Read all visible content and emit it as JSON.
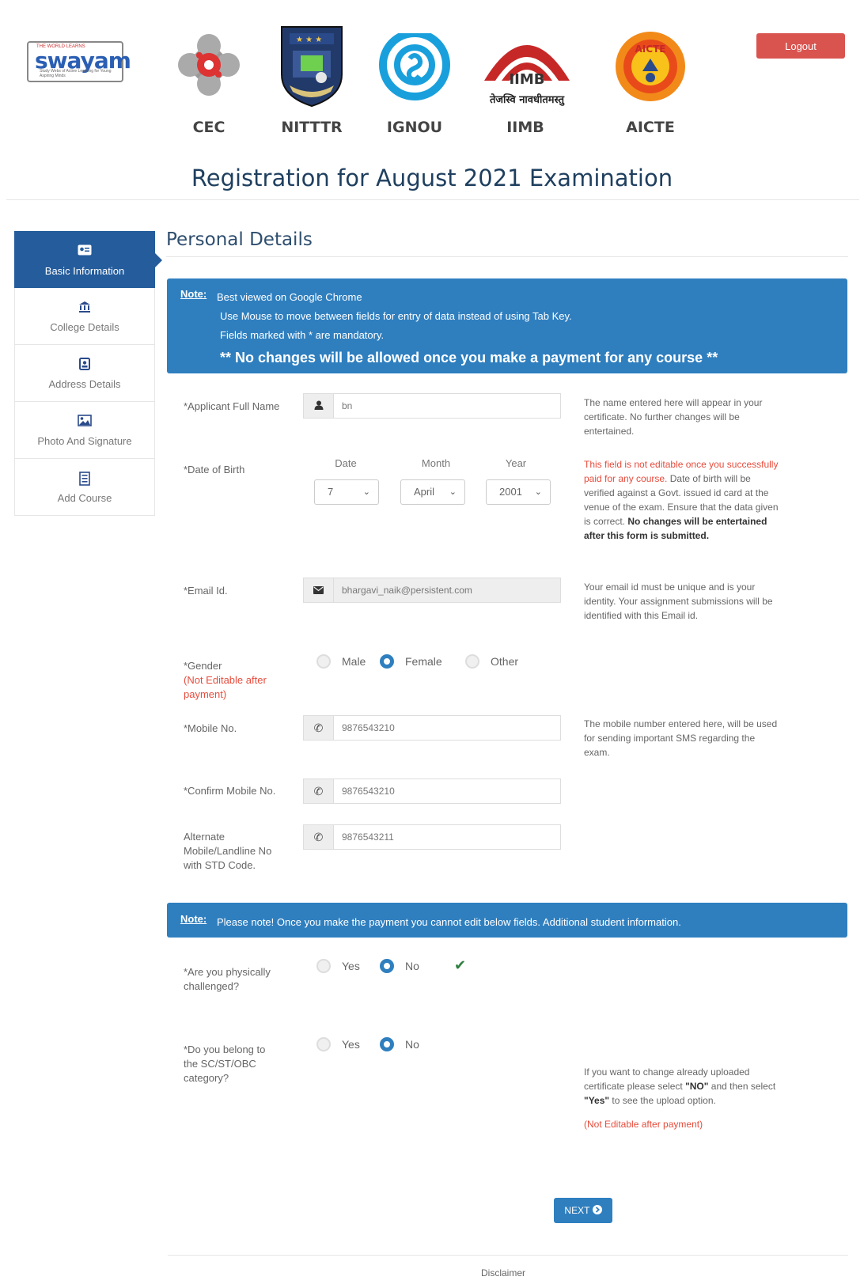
{
  "header": {
    "logo_top": "THE WORLD LEARNS",
    "logo_text": "swayam",
    "logo_sub": "Study Webs of Active Learning for Young Aspiring Minds",
    "partners": [
      {
        "label": "CEC",
        "icon": "cec-logo"
      },
      {
        "label": "NITTTR",
        "icon": "nitttr-crest"
      },
      {
        "label": "IGNOU",
        "icon": "ignou-logo"
      },
      {
        "label": "IIMB",
        "icon": "iimb-logo",
        "emblem_text": "IIMB",
        "motto": "तेजस्वि नावधीतमस्तु"
      },
      {
        "label": "AICTE",
        "icon": "aicte-logo",
        "emblem_text": "AICTE"
      }
    ],
    "logout_label": "Logout",
    "title": "Registration for August 2021 Examination"
  },
  "sidebar": {
    "items": [
      {
        "label": "Basic Information",
        "icon": "id-card-icon",
        "active": true
      },
      {
        "label": "College Details",
        "icon": "institution-icon",
        "active": false
      },
      {
        "label": "Address Details",
        "icon": "address-book-icon",
        "active": false
      },
      {
        "label": "Photo And Signature",
        "icon": "image-icon",
        "active": false
      },
      {
        "label": "Add Course",
        "icon": "list-icon",
        "active": false
      }
    ]
  },
  "main": {
    "title": "Personal Details",
    "note1": {
      "label": "Note:",
      "lines": [
        "Best viewed on Google Chrome",
        "Use Mouse to move between fields for entry of data instead of using Tab Key.",
        "Fields marked with * are mandatory."
      ],
      "big": "** No changes will be allowed once you make a payment for any course **"
    },
    "fields": {
      "name": {
        "label": "*Applicant Full Name",
        "value": "bn",
        "help": "The name entered here will appear in your certificate. No further changes will be entertained."
      },
      "dob": {
        "label": "*Date of Birth",
        "date_head": "Date",
        "month_head": "Month",
        "year_head": "Year",
        "date": "7",
        "month": "April",
        "year": "2001",
        "help_red": "This field is not editable once you successfully paid for any course.",
        "help": "Date of birth will be verified against a Govt. issued id card at the venue of the exam. Ensure that the data given is correct.",
        "help_bold": "No changes will be entertained after this form is submitted."
      },
      "email": {
        "label": "*Email Id.",
        "value": "bhargavi_naik@persistent.com",
        "help": "Your email id must be unique and is your identity. Your assignment submissions will be identified with this Email id."
      },
      "gender": {
        "label": "*Gender",
        "note": "(Not Editable after payment)",
        "options": [
          "Male",
          "Female",
          "Other"
        ],
        "selected": "Female"
      },
      "mobile": {
        "label": "*Mobile No.",
        "value": "9876543210",
        "help": "The mobile number entered here, will be used for sending important SMS regarding the exam."
      },
      "confirm_mobile": {
        "label": "*Confirm Mobile No.",
        "value": "9876543210"
      },
      "alt_mobile": {
        "label": "Alternate Mobile/Landline No with STD Code.",
        "value": "9876543211"
      }
    },
    "note2": {
      "label": "Note:",
      "text": "Please note! Once you make the payment you cannot edit below fields. Additional student information."
    },
    "physically": {
      "label": "*Are you physically challenged?",
      "yes": "Yes",
      "no": "No",
      "selected": "No"
    },
    "category": {
      "label": "*Do you belong to the SC/ST/OBC category?",
      "yes": "Yes",
      "no": "No",
      "selected": "No",
      "help_pre": "If you want to change already uploaded certificate please select ",
      "help_no": "\"NO\"",
      "help_mid": " and then select ",
      "help_yes": "\"Yes\"",
      "help_post": " to see the upload option.",
      "help_red": "(Not Editable after payment)"
    },
    "next_label": "NEXT",
    "disclaimer": "Disclaimer"
  },
  "colors": {
    "primary": "#2f7fbf",
    "sidebar_active": "#245c9c",
    "logout": "#d9534f",
    "warning_text": "#e74c3c"
  }
}
